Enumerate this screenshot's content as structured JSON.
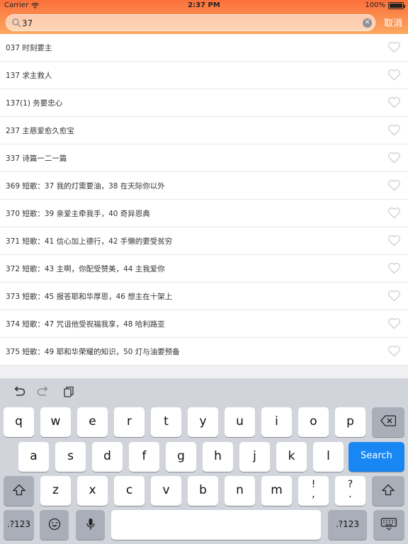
{
  "status_bar": {
    "carrier": "Carrier",
    "time": "2:37 PM",
    "battery": "100%"
  },
  "search": {
    "value": "37",
    "cancel_label": "取消"
  },
  "songs": [
    "037 时刻要主",
    "137 求主救人",
    "137(1) 务要忠心",
    "237 主慈爱愈久愈宝",
    "337 诗篇一二一篇",
    "369 短歌：37 我的灯需要油，38 在天际你以外",
    "370 短歌：39 亲爱主牵我手，40 奇异恩典",
    "371 短歌：41 信心加上德行，42 手懒的要受贫穷",
    "372 短歌：43 主啊，你配受赞美，44 主我爱你",
    "373 短歌：45 报答耶和华厚恩，46 想主在十架上",
    "374 短歌：47 咒诅他受祝福我享，48 哈利路亚",
    "375 短歌：49 耶和华荣耀的知识，50 灯与油要预备"
  ],
  "keyboard": {
    "row1": [
      "q",
      "w",
      "e",
      "r",
      "t",
      "y",
      "u",
      "i",
      "o",
      "p"
    ],
    "row2": [
      "a",
      "s",
      "d",
      "f",
      "g",
      "h",
      "j",
      "k",
      "l"
    ],
    "row3": [
      "z",
      "x",
      "c",
      "v",
      "b",
      "n",
      "m"
    ],
    "row3_punct": [
      [
        "!",
        ","
      ],
      [
        "?",
        "."
      ]
    ],
    "search_label": "Search",
    "numbers_label": ".?123"
  },
  "colors": {
    "header_top": "#fb6f3a",
    "header_bottom": "#fca760",
    "search_key": "#1987f3"
  }
}
